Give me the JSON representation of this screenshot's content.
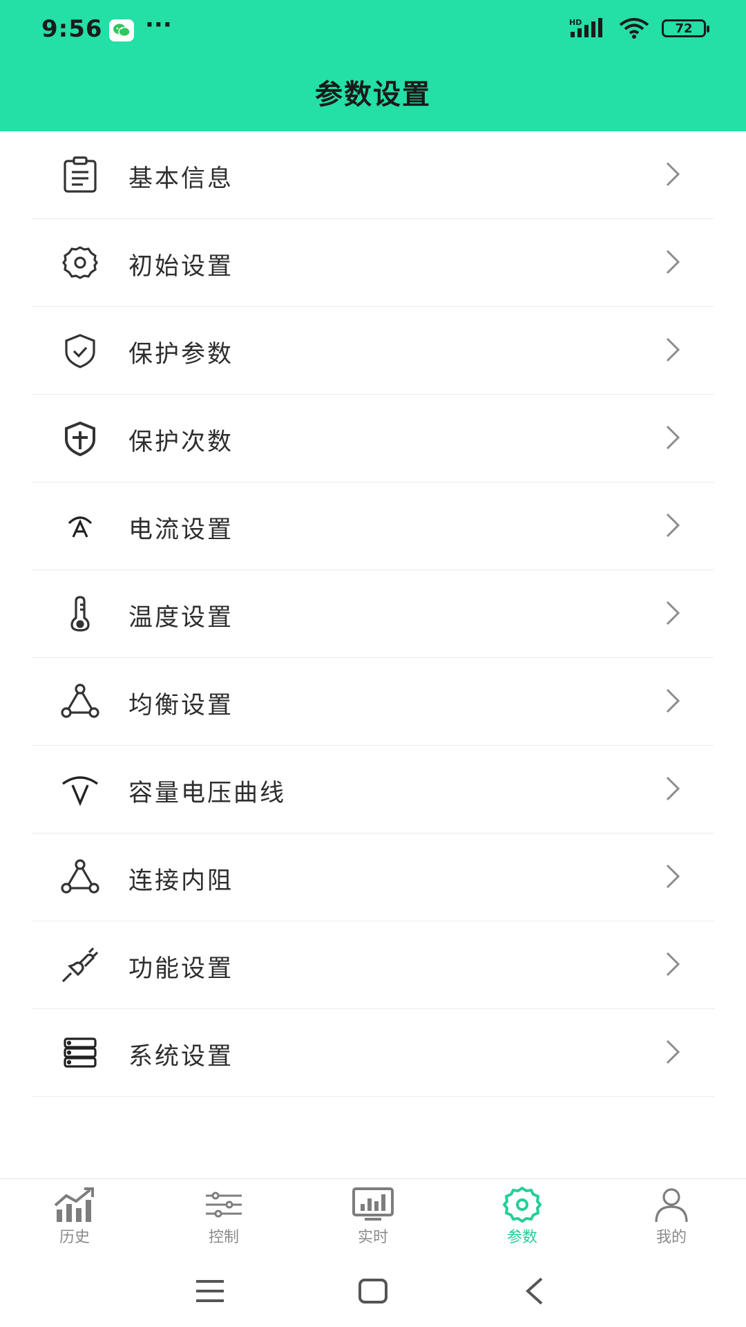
{
  "status_bar": {
    "time": "9:56",
    "dots": "···",
    "network": "HD",
    "battery": "72"
  },
  "header": {
    "title": "参数设置"
  },
  "menu": {
    "items": [
      {
        "label": "基本信息",
        "icon": "clipboard-icon"
      },
      {
        "label": "初始设置",
        "icon": "gear-icon"
      },
      {
        "label": "保护参数",
        "icon": "shield-check-icon"
      },
      {
        "label": "保护次数",
        "icon": "shield-plus-icon"
      },
      {
        "label": "电流设置",
        "icon": "current-icon"
      },
      {
        "label": "温度设置",
        "icon": "thermometer-icon"
      },
      {
        "label": "均衡设置",
        "icon": "network-icon"
      },
      {
        "label": "容量电压曲线",
        "icon": "voltage-curve-icon"
      },
      {
        "label": "连接内阻",
        "icon": "network-icon"
      },
      {
        "label": "功能设置",
        "icon": "plug-icon"
      },
      {
        "label": "系统设置",
        "icon": "server-icon"
      }
    ]
  },
  "tabbar": {
    "tabs": [
      {
        "label": "历史",
        "icon": "history-chart-icon"
      },
      {
        "label": "控制",
        "icon": "sliders-icon"
      },
      {
        "label": "实时",
        "icon": "monitor-icon"
      },
      {
        "label": "参数",
        "icon": "gear-icon"
      },
      {
        "label": "我的",
        "icon": "user-icon"
      }
    ],
    "active": 3
  },
  "colors": {
    "accent": "#24dfa6",
    "active_tab": "#24cf98"
  }
}
